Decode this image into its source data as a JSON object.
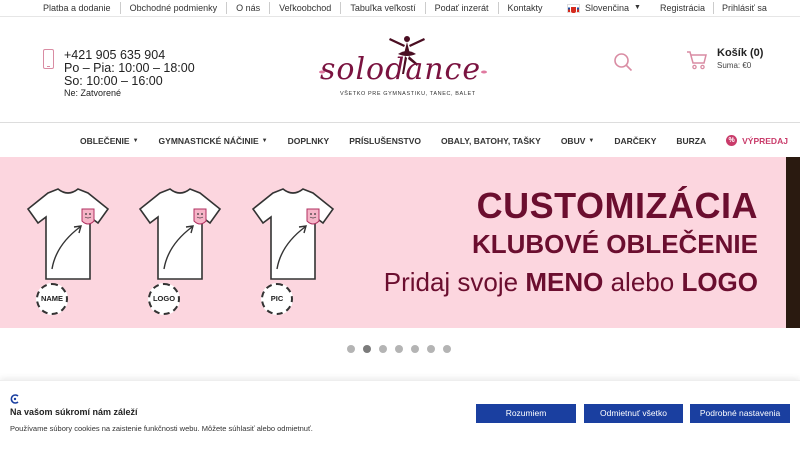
{
  "topbar": {
    "links": [
      "Platba a dodanie",
      "Obchodné podmienky",
      "O nás",
      "Veľkoobchod",
      "Tabuľka veľkostí",
      "Podať inzerát",
      "Kontakty"
    ],
    "language": "Slovenčina",
    "register": "Registrácia",
    "login": "Prihlásiť sa"
  },
  "contact": {
    "phone": "+421 905 635 904",
    "hours_weekday": "Po – Pia: 10:00 – 18:00",
    "hours_saturday": "So: 10:00 – 16:00",
    "hours_sunday": "Ne: Zatvorené"
  },
  "logo": {
    "text": "solodance",
    "tagline": "VŠETKO PRE GYMNASTIKU, TANEC, BALET"
  },
  "cart": {
    "title": "Košík (0)",
    "sum": "Suma: €0"
  },
  "nav": {
    "items": [
      "OBLEČENIE",
      "GYMNASTICKÉ NÁČINIE",
      "DOPLNKY",
      "PRÍSLUŠENSTVO",
      "OBALY, BATOHY, TAŠKY",
      "OBUV",
      "DARČEKY",
      "BURZA"
    ],
    "sale": "VÝPREDAJ"
  },
  "banner": {
    "line1": "CUSTOMIZÁCIA",
    "line2": "KLUBOVÉ OBLEČENIE",
    "line3_pre": "Pridaj svoje ",
    "line3_name": "MENO",
    "line3_mid": " alebo ",
    "line3_logo": "LOGO",
    "labels": [
      "NAME",
      "LOGO",
      "PIC"
    ],
    "accent_color": "#6b0e2f",
    "background_color": "#fcd6df"
  },
  "slider": {
    "count": 7,
    "active_index": 1
  },
  "cookie": {
    "title": "Na vašom súkromí nám záleží",
    "text": "Používame súbory cookies na zaistenie funkčnosti webu. Môžete súhlasiť alebo odmietnuť.",
    "accept": "Rozumiem",
    "reject": "Odmietnuť všetko",
    "settings": "Podrobné nastavenia",
    "button_color": "#1a3fa0"
  }
}
